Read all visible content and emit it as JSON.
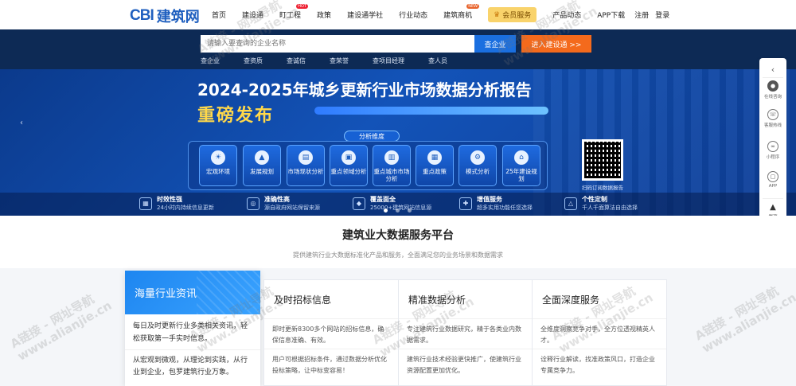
{
  "header": {
    "logo_mark": "CBI",
    "logo_name": "建筑网",
    "nav": [
      {
        "label": "首页"
      },
      {
        "label": "建设通"
      },
      {
        "label": "盯工程",
        "badge": "HOT"
      },
      {
        "label": "政策"
      },
      {
        "label": "建设通学社"
      },
      {
        "label": "行业动态"
      },
      {
        "label": "建筑商机",
        "badge": "NEW"
      },
      {
        "label": "会员服务"
      },
      {
        "label": "产品动态"
      },
      {
        "label": "APP下载"
      },
      {
        "label": "注册"
      },
      {
        "label": "登录"
      }
    ]
  },
  "search": {
    "placeholder": "请输入要查询的企业名称",
    "button": "查企业",
    "enter_button": "进入建设通 >>",
    "tabs": [
      "查企业",
      "查资质",
      "查诚信",
      "查荣誉",
      "查项目经理",
      "查人员"
    ]
  },
  "banner": {
    "title": "2024-2025年城乡更新行业市场数据分析报告",
    "subtitle": "重磅发布",
    "dimension_label": "分析维度",
    "features": [
      {
        "label": "宏观环境",
        "icon": "bulb-icon"
      },
      {
        "label": "发展规划",
        "icon": "chart-icon"
      },
      {
        "label": "市场现状分析",
        "icon": "doc-icon"
      },
      {
        "label": "重点领域分析",
        "icon": "screen-icon"
      },
      {
        "label": "重点城市市场分析",
        "icon": "city-icon"
      },
      {
        "label": "重点政策",
        "icon": "book-icon"
      },
      {
        "label": "模式分析",
        "icon": "gear-icon"
      },
      {
        "label": "25年建设规划",
        "icon": "house-icon"
      }
    ],
    "qr_caption": "扫码订阅数据报告",
    "bottom_features": [
      {
        "title": "时效性强",
        "desc": "24小时内持续信息更新",
        "icon": "calendar-icon"
      },
      {
        "title": "准确性高",
        "desc": "源自政府网站保留来源",
        "icon": "target-icon"
      },
      {
        "title": "覆盖面全",
        "desc": "25000+建筑网站信息源",
        "icon": "cube-icon"
      },
      {
        "title": "增值服务",
        "desc": "超多实用功能任您选择",
        "icon": "puzzle-icon"
      },
      {
        "title": "个性定制",
        "desc": "千人千面算法自由选择",
        "icon": "shape-icon"
      }
    ]
  },
  "side_toolbar": [
    {
      "label": "",
      "icon": "chevron-left-icon"
    },
    {
      "label": "在线咨询",
      "icon": "chat-icon"
    },
    {
      "label": "客服热线",
      "icon": "phone-icon"
    },
    {
      "label": "小程序",
      "icon": "miniapp-icon"
    },
    {
      "label": "APP",
      "icon": "app-icon"
    },
    {
      "label": "置顶",
      "icon": "top-icon"
    }
  ],
  "platform": {
    "title": "建筑业大数据服务平台",
    "subtitle": "提供建筑行业大数据标准化产品和服务，全面满足您的业务场景和数据需求"
  },
  "services": [
    {
      "title": "海量行业资讯",
      "desc1": "每日及时更新行业多类相关资讯，轻松获取第一手实时信息。",
      "desc2": "从宏观到微观，从理论到实践，从行业到企业，包罗建筑行业万象。"
    },
    {
      "title": "及时招标信息",
      "desc1": "即时更新8300多个网站的招标信息，确保信息准确、有效。",
      "desc2": "用户可根据招标条件，通过数据分析优化投标策略，让中标变容易！"
    },
    {
      "title": "精准数据分析",
      "desc1": "专注建筑行业数据研究，精于各类业内数据需求。",
      "desc2": "建筑行业技术经验更快推广，使建筑行业资源配置更加优化。"
    },
    {
      "title": "全面深度服务",
      "desc1": "全维度洞察竞争对手，全方位透视精英人才。",
      "desc2": "诠释行业解读，找准政策风口，打造企业专属竞争力。"
    }
  ],
  "watermark": {
    "line1": "A链接 - 网址导航",
    "line2": "www.alianjie.cn"
  }
}
